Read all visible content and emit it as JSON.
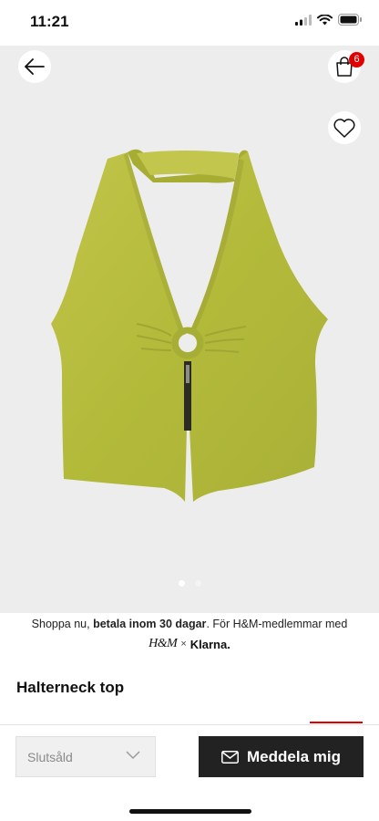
{
  "status_bar": {
    "time": "11:21",
    "icons": [
      "signal-icon",
      "wifi-icon",
      "battery-icon"
    ]
  },
  "product": {
    "image_description_icon": "halter-top-image",
    "title": "Halterneck top",
    "carousel": {
      "current": 1,
      "total": 2
    }
  },
  "header_actions": {
    "back_icon": "arrow-left-icon",
    "bag_icon": "shopping-bag-icon",
    "bag_count": "6",
    "favorite_icon": "heart-icon"
  },
  "klarna_banner": {
    "text_prefix": "Shoppa nu, ",
    "text_bold": "betala inom 30 dagar",
    "text_suffix": ". För H&M-medlemmar med",
    "hm_logo": "H&M",
    "times": "×",
    "klarna_logo": "Klarna."
  },
  "actions": {
    "size_select_value": "Slutsåld",
    "notify_button_label": "Meddela mig",
    "notify_icon": "envelope-icon"
  },
  "colors": {
    "brand_red": "#e00000",
    "button_dark": "#222222",
    "garment": "#b6bd3c",
    "background": "#ededed"
  }
}
